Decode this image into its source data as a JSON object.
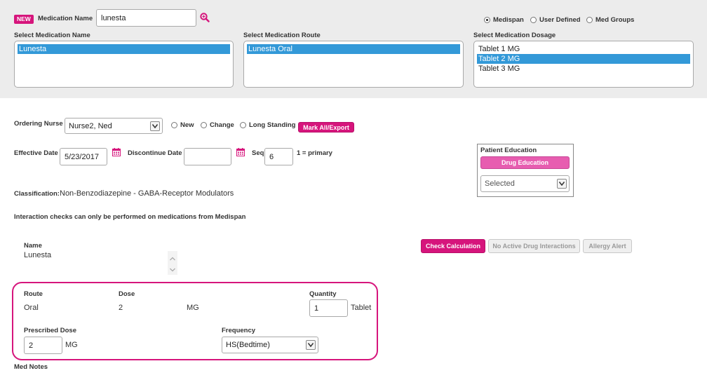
{
  "header": {
    "new_badge": "NEW",
    "medication_name_label": "Medication Name",
    "medication_name_value": "lunesta",
    "source_options": [
      {
        "label": "Medispan",
        "selected": true
      },
      {
        "label": "User Defined",
        "selected": false
      },
      {
        "label": "Med Groups",
        "selected": false
      }
    ]
  },
  "selectors": {
    "name_label": "Select Medication Name",
    "name_options": [
      {
        "label": "Lunesta",
        "selected": true
      }
    ],
    "route_label": "Select Medication Route",
    "route_options": [
      {
        "label": "Lunesta Oral",
        "selected": true
      }
    ],
    "dosage_label": "Select Medication Dosage",
    "dosage_options": [
      {
        "label": "Tablet 1 MG",
        "selected": false
      },
      {
        "label": "Tablet 2 MG",
        "selected": true
      },
      {
        "label": "Tablet 3 MG",
        "selected": false
      }
    ]
  },
  "order": {
    "ordering_nurse_label": "Ordering Nurse",
    "ordering_nurse_value": "Nurse2, Ned",
    "type_options": [
      {
        "label": "New",
        "selected": false
      },
      {
        "label": "Change",
        "selected": false
      },
      {
        "label": "Long Standing",
        "selected": false
      }
    ],
    "mark_all_label": "Mark All/Export",
    "effective_date_label": "Effective Date",
    "effective_date_value": "5/23/2017",
    "discontinue_date_label": "Discontinue Date",
    "discontinue_date_value": "",
    "seq_label": "Seq",
    "seq_value": "6",
    "seq_hint": "1 = primary"
  },
  "patient_education": {
    "title": "Patient Education",
    "button_label": "Drug Education",
    "select_value": "Selected"
  },
  "classification": {
    "label": "Classification:",
    "value": "Non-Benzodiazepine - GABA-Receptor Modulators"
  },
  "interaction_note": "Interaction checks can only be performed on medications from Medispan",
  "detail": {
    "name_label": "Name",
    "name_value": "Lunesta",
    "check_calc_label": "Check Calculation",
    "no_interactions_label": "No Active Drug Interactions",
    "allergy_alert_label": "Allergy Alert",
    "route_label": "Route",
    "route_value": "Oral",
    "dose_label": "Dose",
    "dose_value": "2",
    "dose_unit": "MG",
    "quantity_label": "Quantity",
    "quantity_value": "1",
    "quantity_unit": "Tablet",
    "prescribed_dose_label": "Prescribed Dose",
    "prescribed_dose_value": "2",
    "prescribed_dose_unit": "MG",
    "frequency_label": "Frequency",
    "frequency_value": "HS(Bedtime)",
    "med_notes_label": "Med Notes"
  },
  "colors": {
    "accent": "#d6157c",
    "selection": "#3399d8",
    "band": "#ececec"
  }
}
